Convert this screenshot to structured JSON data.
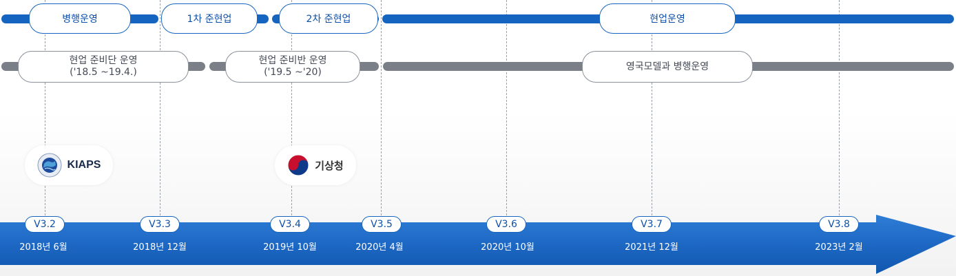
{
  "phases_top": [
    {
      "label": "병행운영"
    },
    {
      "label": "1차 준현업"
    },
    {
      "label": "2차 준현업"
    },
    {
      "label": "현업운영"
    }
  ],
  "phases_bottom": [
    {
      "label": "현업 준비단 운영",
      "sub": "('18.5 ~19.4.)"
    },
    {
      "label": "현업 준비반 운영",
      "sub": "('19.5 ~'20)"
    },
    {
      "label": "영국모델과 병행운영",
      "sub": ""
    }
  ],
  "logos": {
    "kiaps": "KIAPS",
    "kma": "기상청"
  },
  "milestones": [
    {
      "version": "V3.2",
      "date": "2018년 6월"
    },
    {
      "version": "V3.3",
      "date": "2018년 12월"
    },
    {
      "version": "V3.4",
      "date": "2019년 10월"
    },
    {
      "version": "V3.5",
      "date": "2020년 4월"
    },
    {
      "version": "V3.6",
      "date": "2020년 10월"
    },
    {
      "version": "V3.7",
      "date": "2021년 12월"
    },
    {
      "version": "V3.8",
      "date": "2023년 2월"
    }
  ],
  "colors": {
    "primary": "#1565c0",
    "track_gray": "#7a7f88"
  }
}
